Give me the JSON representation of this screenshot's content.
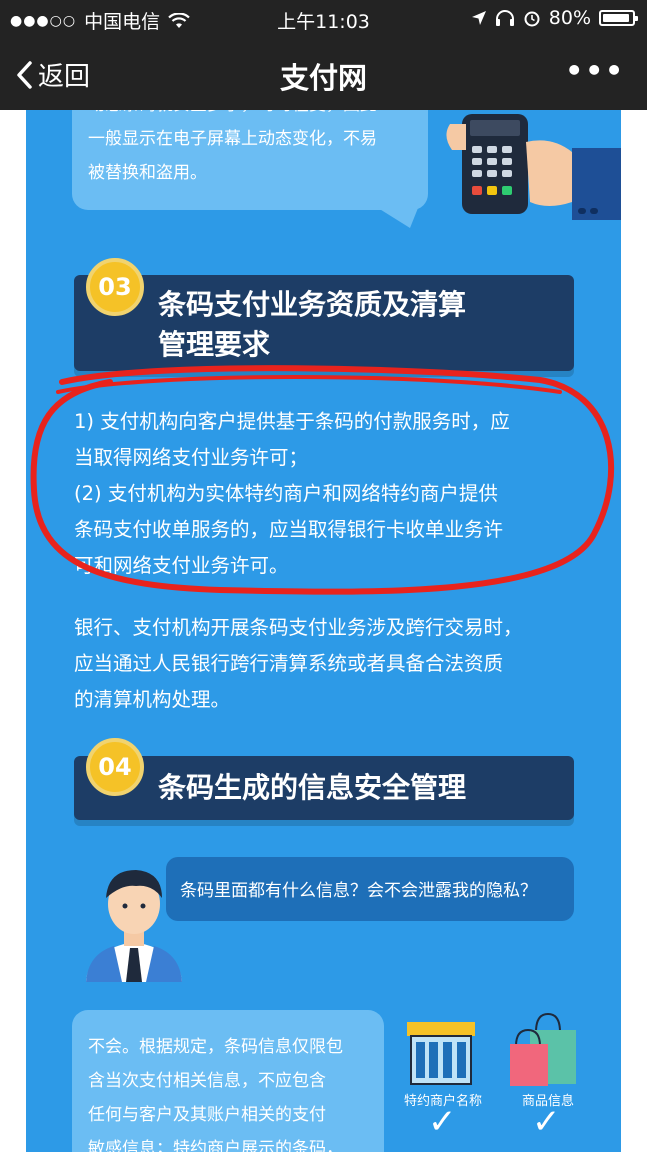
{
  "status_bar": {
    "carrier": "中国电信",
    "time": "上午11:03",
    "battery": "80%",
    "battery_level": 0.8
  },
  "nav": {
    "back_label": "返回",
    "title": "支付网",
    "more_label": "•••"
  },
  "article": {
    "top_bubble_lines": [
      "动态条码就安全多了，时时在变，因此",
      "一般显示在电子屏幕上动态变化，不易",
      "被替换和盗用。"
    ],
    "section3": {
      "badge": "03",
      "title_line1": "条码支付业务资质及清算",
      "title_line2": "管理要求"
    },
    "requirements": [
      "1) 支付机构向客户提供基于条码的付款服务时，应",
      "当取得网络支付业务许可；",
      "(2) 支付机构为实体特约商户和网络特约商户提供",
      "条码支付收单服务的，应当取得银行卡收单业务许",
      "可和网络支付业务许可。"
    ],
    "clearing_text": [
      "银行、支付机构开展条码支付业务涉及跨行交易时，",
      "应当通过人民银行跨行清算系统或者具备合法资质",
      "的清算机构处理。"
    ],
    "section4": {
      "badge": "04",
      "title": "条码生成的信息安全管理"
    },
    "question": "条码里面都有什么信息？会不会泄露我的隐私？",
    "answer_lines": [
      "不会。根据规定，条码信息仅限包",
      "含当次支付相关信息，不应包含",
      "任何与客户及其账户相关的支付",
      "敏感信息；特约商户展示的条码，"
    ],
    "icon_captions": {
      "merchant": "特约商户名称",
      "goods": "商品信息"
    }
  },
  "colors": {
    "background": "#2d9ae7",
    "header_bg": "#1d3d66",
    "badge": "#f5c227",
    "annotation": "#e8231d",
    "bar": "#232323"
  }
}
